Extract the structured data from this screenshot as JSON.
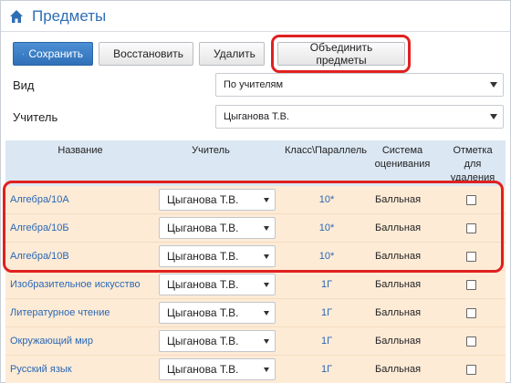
{
  "window": {
    "title": "Предметы"
  },
  "toolbar": {
    "save_label": "Сохранить",
    "restore_label": "Восстановить",
    "delete_label": "Удалить",
    "merge_label": "Объединить предметы"
  },
  "filters": {
    "view_label": "Вид",
    "view_value": "По учителям",
    "teacher_label": "Учитель",
    "teacher_value": "Цыганова Т.В."
  },
  "table": {
    "headers": {
      "name": "Название",
      "teacher": "Учитель",
      "class_line1": "Класс\\Параллель",
      "system_line1": "Система",
      "system_line2": "оценивания",
      "mark_line1": "Отметка",
      "mark_line2": "для",
      "mark_line3": "удаления"
    },
    "rows": [
      {
        "name": "Алгебра/10А",
        "teacher": "Цыганова Т.В.",
        "class": "10*",
        "system": "Балльная",
        "checked": false
      },
      {
        "name": "Алгебра/10Б",
        "teacher": "Цыганова Т.В.",
        "class": "10*",
        "system": "Балльная",
        "checked": false
      },
      {
        "name": "Алгебра/10В",
        "teacher": "Цыганова Т.В.",
        "class": "10*",
        "system": "Балльная",
        "checked": false
      },
      {
        "name": "Изобразительное искусство",
        "teacher": "Цыганова Т.В.",
        "class": "1Г",
        "system": "Балльная",
        "checked": false
      },
      {
        "name": "Литературное чтение",
        "teacher": "Цыганова Т.В.",
        "class": "1Г",
        "system": "Балльная",
        "checked": false
      },
      {
        "name": "Окружающий мир",
        "teacher": "Цыганова Т.В.",
        "class": "1Г",
        "system": "Балльная",
        "checked": false
      },
      {
        "name": "Русский язык",
        "teacher": "Цыганова Т.В.",
        "class": "1Г",
        "system": "Балльная",
        "checked": false
      }
    ]
  },
  "colors": {
    "accent": "#2f6eb5",
    "header_bg": "#dbe7f3",
    "row_bg": "#fdebd6",
    "highlight": "#e02020"
  },
  "icons": [
    "home-icon",
    "save-icon",
    "restore-icon",
    "delete-icon",
    "chevron-down-icon"
  ]
}
